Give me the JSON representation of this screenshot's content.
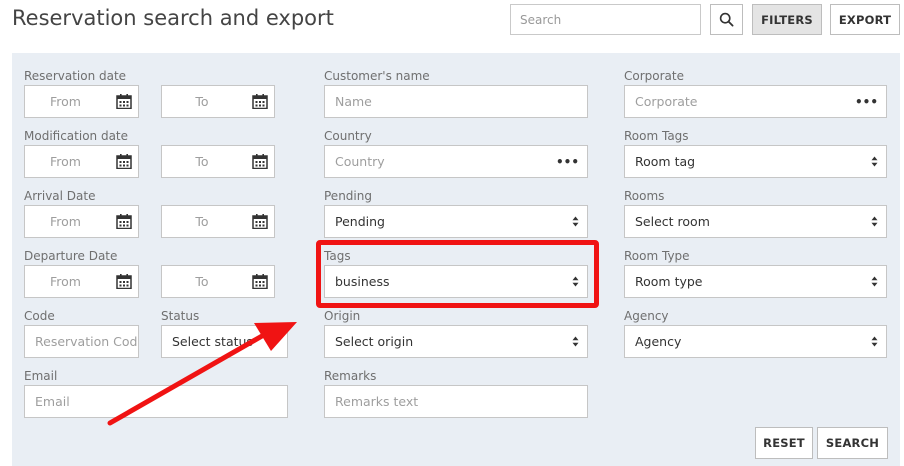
{
  "header": {
    "title": "Reservation search and export",
    "search_placeholder": "Search",
    "filters_label": "FILTERS",
    "export_label": "EXPORT"
  },
  "filters": {
    "reservation_date": {
      "label": "Reservation date",
      "from": "From",
      "to": "To"
    },
    "modification_date": {
      "label": "Modification date",
      "from": "From",
      "to": "To"
    },
    "arrival_date": {
      "label": "Arrival Date",
      "from": "From",
      "to": "To"
    },
    "departure_date": {
      "label": "Departure Date",
      "from": "From",
      "to": "To"
    },
    "code": {
      "label": "Code",
      "placeholder": "Reservation Code"
    },
    "status": {
      "label": "Status",
      "value": "Select status"
    },
    "email": {
      "label": "Email",
      "placeholder": "Email"
    },
    "customer_name": {
      "label": "Customer's name",
      "placeholder": "Name"
    },
    "country": {
      "label": "Country",
      "placeholder": "Country"
    },
    "pending": {
      "label": "Pending",
      "value": "Pending"
    },
    "tags": {
      "label": "Tags",
      "value": "business"
    },
    "origin": {
      "label": "Origin",
      "value": "Select origin"
    },
    "remarks": {
      "label": "Remarks",
      "placeholder": "Remarks text"
    },
    "corporate": {
      "label": "Corporate",
      "placeholder": "Corporate"
    },
    "room_tags": {
      "label": "Room Tags",
      "value": "Room tag"
    },
    "rooms": {
      "label": "Rooms",
      "value": "Select room"
    },
    "room_type": {
      "label": "Room Type",
      "value": "Room type"
    },
    "agency": {
      "label": "Agency",
      "value": "Agency"
    }
  },
  "actions": {
    "reset_label": "RESET",
    "search_label": "SEARCH"
  },
  "icons": {
    "search": "search-icon",
    "calendar": "calendar-icon",
    "more": "more-dots-icon",
    "select": "select-caret-icon"
  },
  "annotation": {
    "highlight_color": "#f01313"
  }
}
